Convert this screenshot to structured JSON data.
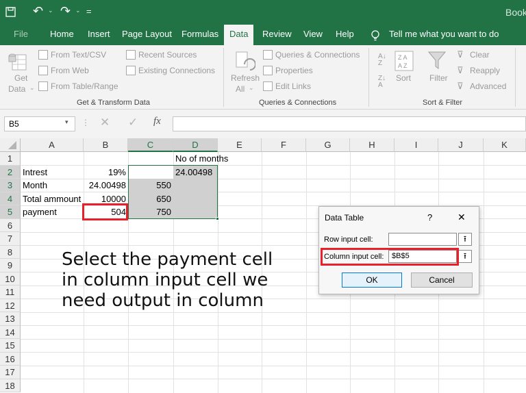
{
  "titlebar": {
    "book_text": "Book",
    "qat_extra": "="
  },
  "tabs": [
    "File",
    "Home",
    "Insert",
    "Page Layout",
    "Formulas",
    "Data",
    "Review",
    "View",
    "Help"
  ],
  "tell_me": "Tell me what you want to do",
  "ribbon": {
    "get_data": "Get",
    "get_data2": "Data",
    "from_text_csv": "From Text/CSV",
    "from_web": "From Web",
    "from_table": "From Table/Range",
    "recent_sources": "Recent Sources",
    "existing_connections": "Existing Connections",
    "group_get_transform": "Get & Transform Data",
    "refresh": "Refresh",
    "refresh_all": "All",
    "queries_connections": "Queries & Connections",
    "properties": "Properties",
    "edit_links": "Edit Links",
    "group_queries": "Queries & Connections",
    "sort": "Sort",
    "filter": "Filter",
    "clear": "Clear",
    "reapply": "Reapply",
    "advanced": "Advanced",
    "group_sort_filter": "Sort & Filter"
  },
  "formula_bar": {
    "name_box": "B5",
    "fx": "fx",
    "value": ""
  },
  "columns": [
    "A",
    "B",
    "C",
    "D",
    "E",
    "F",
    "G",
    "H",
    "I",
    "J",
    "K"
  ],
  "rows": [
    "1",
    "2",
    "3",
    "4",
    "5",
    "6",
    "7",
    "8",
    "9",
    "10",
    "11",
    "12",
    "13",
    "14",
    "15",
    "16",
    "17",
    "18"
  ],
  "cells": {
    "d1": "No of months",
    "a2": "Intrest",
    "b2": "19%",
    "d2": "24.00498",
    "a3": "Month",
    "b3": "24.00498",
    "c3": "550",
    "a4": "Total ammount",
    "b4": "10000",
    "c4": "650",
    "a5": "payment",
    "b5": "504",
    "c5": "750"
  },
  "annotation": "Select the payment cell in column input cell we need output in column",
  "dialog": {
    "title": "Data Table",
    "help": "?",
    "close": "✕",
    "row_label": "Row input cell:",
    "row_value": "",
    "col_label": "Column input cell:",
    "col_value": "$B$5",
    "ok": "OK",
    "cancel": "Cancel"
  },
  "colors": {
    "excel_green": "#217346",
    "highlight_red": "#e8202a",
    "table_gray": "#d0d0d0"
  }
}
